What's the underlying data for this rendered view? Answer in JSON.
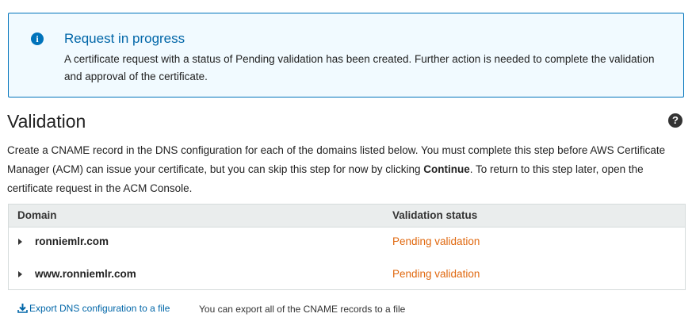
{
  "alert": {
    "icon": "info-icon",
    "title": "Request in progress",
    "body": "A certificate request with a status of Pending validation has been created. Further action is needed to complete the validation and approval of the certificate.",
    "accent_color": "#0073bb",
    "background_color": "#f1faff"
  },
  "validation": {
    "title": "Validation",
    "help_icon": "question-circle-icon",
    "description_part1": "Create a CNAME record in the DNS configuration for each of the domains listed below. You must complete this step before AWS Certificate Manager (ACM) can issue your certificate, but you can skip this step for now by clicking ",
    "description_bold": "Continue",
    "description_part2": ". To return to this step later, open the certificate request in the ACM Console."
  },
  "table": {
    "columns": [
      "Domain",
      "Validation status"
    ],
    "rows": [
      {
        "domain": "ronniemlr.com",
        "status": "Pending validation"
      },
      {
        "domain": "www.ronniemlr.com",
        "status": "Pending validation"
      }
    ],
    "pending_color": "#e0680f"
  },
  "export": {
    "icon": "download-icon",
    "link_label": "Export DNS configuration to a file",
    "note": "You can export all of the CNAME records to a file"
  }
}
